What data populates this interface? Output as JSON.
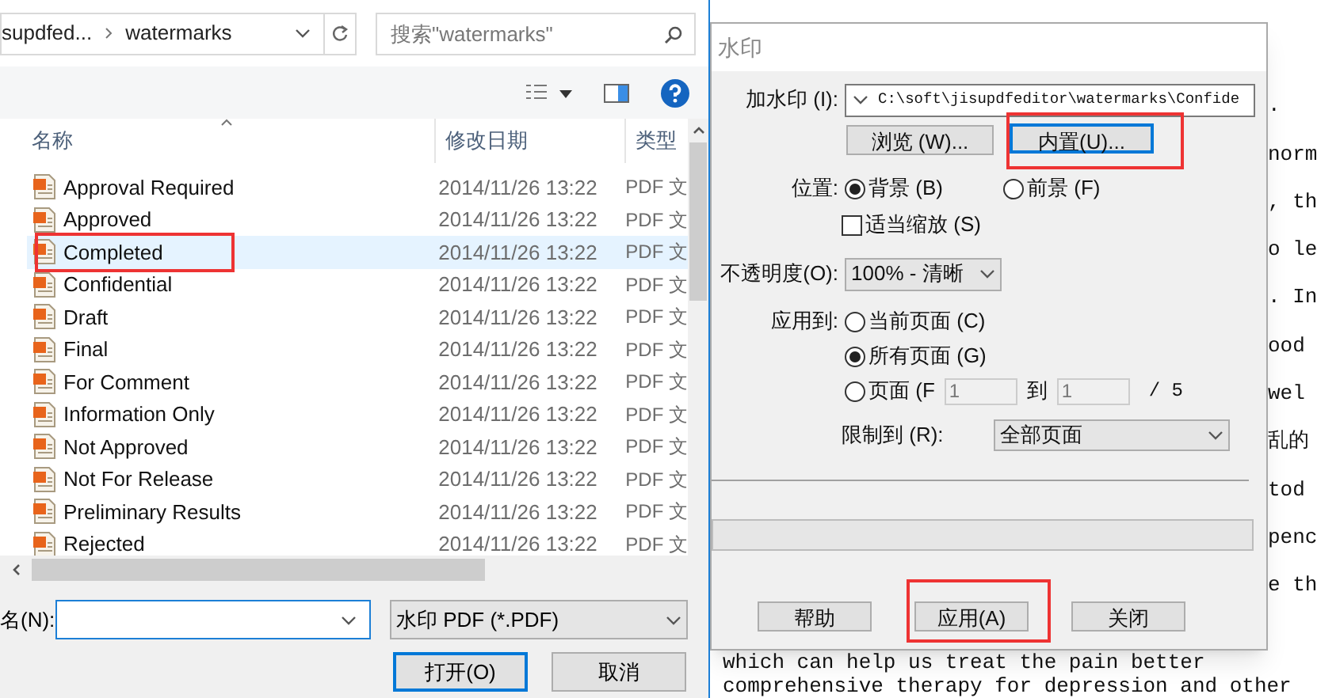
{
  "file_dialog": {
    "breadcrumb": [
      "supdfed...",
      "watermarks"
    ],
    "search": {
      "placeholder": "搜索\"watermarks\""
    },
    "columns": [
      "名称",
      "修改日期",
      "类型"
    ],
    "rows": [
      {
        "name": "Approval Required",
        "date": "2014/11/26 13:22",
        "type": "PDF 文",
        "selected": false,
        "highlighted": false
      },
      {
        "name": "Approved",
        "date": "2014/11/26 13:22",
        "type": "PDF 文",
        "selected": false,
        "highlighted": false
      },
      {
        "name": "Completed",
        "date": "2014/11/26 13:22",
        "type": "PDF 文",
        "selected": true,
        "highlighted": true
      },
      {
        "name": "Confidential",
        "date": "2014/11/26 13:22",
        "type": "PDF 文",
        "selected": false,
        "highlighted": false
      },
      {
        "name": "Draft",
        "date": "2014/11/26 13:22",
        "type": "PDF 文",
        "selected": false,
        "highlighted": false
      },
      {
        "name": "Final",
        "date": "2014/11/26 13:22",
        "type": "PDF 文",
        "selected": false,
        "highlighted": false
      },
      {
        "name": "For Comment",
        "date": "2014/11/26 13:22",
        "type": "PDF 文",
        "selected": false,
        "highlighted": false
      },
      {
        "name": "Information Only",
        "date": "2014/11/26 13:22",
        "type": "PDF 文",
        "selected": false,
        "highlighted": false
      },
      {
        "name": "Not Approved",
        "date": "2014/11/26 13:22",
        "type": "PDF 文",
        "selected": false,
        "highlighted": false
      },
      {
        "name": "Not For Release",
        "date": "2014/11/26 13:22",
        "type": "PDF 文",
        "selected": false,
        "highlighted": false
      },
      {
        "name": "Preliminary Results",
        "date": "2014/11/26 13:22",
        "type": "PDF 文",
        "selected": false,
        "highlighted": false
      },
      {
        "name": "Rejected",
        "date": "2014/11/26 13:22",
        "type": "PDF 文",
        "selected": false,
        "highlighted": false
      }
    ],
    "filename_label": "名(N):",
    "filetype": "水印 PDF (*.PDF)",
    "buttons": [
      {
        "label": "打开(O)",
        "default": true
      },
      {
        "label": "取消",
        "default": false
      }
    ]
  },
  "watermark_dialog": {
    "title": "水印",
    "source_label": "加水印 (I):",
    "source_path": "C:\\soft\\jisupdfeditor\\watermarks\\Confide",
    "source_buttons": [
      {
        "label": "浏览 (W)...",
        "focused": false,
        "highlighted": false
      },
      {
        "label": "内置(U)...",
        "focused": true,
        "highlighted": true
      }
    ],
    "position_label": "位置:",
    "position_options": [
      {
        "label": "背景 (B)",
        "selected": true
      },
      {
        "label": "前景 (F)",
        "selected": false
      }
    ],
    "scale": {
      "label": "适当缩放 (S)",
      "checked": false
    },
    "opacity_label": "不透明度(O):",
    "opacity": "100% - 清晰",
    "apply_label": "应用到:",
    "apply_options": [
      {
        "label": "当前页面 (C)",
        "selected": false
      },
      {
        "label": "所有页面 (G)",
        "selected": true
      },
      {
        "label": "页面 (F",
        "selected": false
      }
    ],
    "page_from": "1",
    "page_to_label": "到",
    "page_to": "1",
    "page_total": "/ 5",
    "limit_label": "限制到 (R):",
    "limit": "全部页面",
    "progress": {
      "level": 0
    },
    "buttons": [
      {
        "label": "帮助",
        "highlighted": false
      },
      {
        "label": "应用(A)",
        "highlighted": true
      },
      {
        "label": "关闭",
        "highlighted": false
      }
    ]
  },
  "document": {
    "fragments": [
      ".",
      "norm",
      ", th",
      "o le",
      ". In",
      "ood",
      "wel",
      "乱的",
      "tod",
      "penc",
      "e th"
    ],
    "lines": [
      "which can help us treat the pain better",
      "comprehensive therapy for depression and other"
    ]
  }
}
